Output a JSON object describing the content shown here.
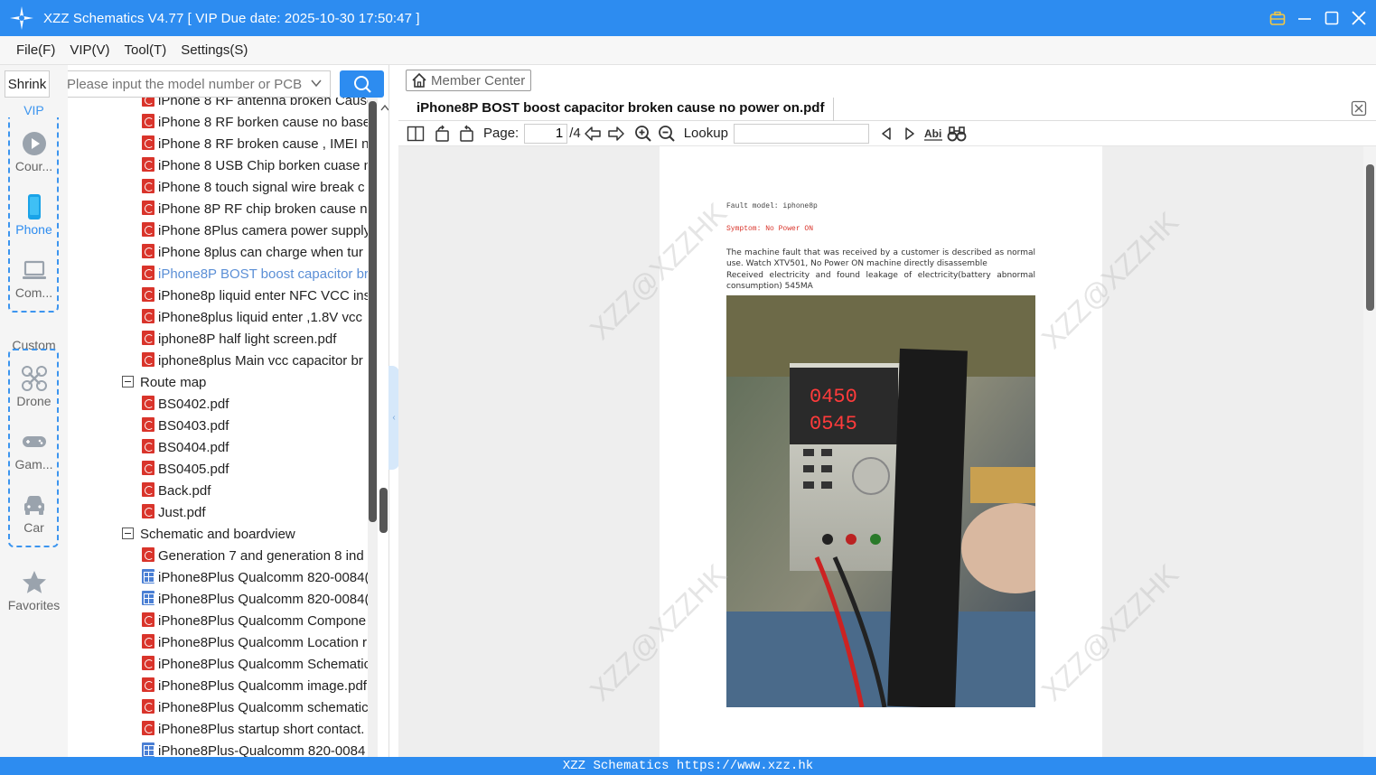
{
  "titlebar": {
    "title": "XZZ Schematics V4.77 [ VIP Due date: 2025-10-30 17:50:47 ]"
  },
  "menu": [
    "File(F)",
    "VIP(V)",
    "Tool(T)",
    "Settings(S)"
  ],
  "rail": {
    "shrink_label": "Shrink",
    "vip_group_label": "VIP",
    "custom_group_label": "Custom",
    "items": [
      {
        "label": "Cour...",
        "icon": "play-circle-icon"
      },
      {
        "label": "Phone",
        "icon": "phone-icon"
      },
      {
        "label": "Com...",
        "icon": "laptop-icon"
      },
      {
        "label": "Drone",
        "icon": "drone-icon"
      },
      {
        "label": "Gam...",
        "icon": "gamepad-icon"
      },
      {
        "label": "Car",
        "icon": "car-icon"
      },
      {
        "label": "Favorites",
        "icon": "star-icon"
      }
    ]
  },
  "search": {
    "placeholder": "Please input the model number or PCB"
  },
  "tree": {
    "rows": [
      {
        "label": "iPhone 8 RF antenna broken Cause",
        "type": "pdf"
      },
      {
        "label": "iPhone 8 RF borken cause no base",
        "type": "pdf"
      },
      {
        "label": "iPhone 8 RF broken cause , IMEI no",
        "type": "pdf"
      },
      {
        "label": "iPhone 8 USB Chip borken cuase n",
        "type": "pdf"
      },
      {
        "label": "iPhone 8 touch signal wire break c",
        "type": "pdf"
      },
      {
        "label": "iPhone 8P RF chip broken cause no",
        "type": "pdf"
      },
      {
        "label": "iPhone 8Plus camera power supply",
        "type": "pdf"
      },
      {
        "label": "iPhone 8plus can charge when tur",
        "type": "pdf"
      },
      {
        "label": "iPhone8P BOST boost capacitor br",
        "type": "pdf",
        "highlight": true
      },
      {
        "label": "iPhone8p liquid enter NFC VCC ins",
        "type": "pdf"
      },
      {
        "label": "iPhone8plus liquid enter ,1.8V vcc",
        "type": "pdf"
      },
      {
        "label": "iphone8P half light screen.pdf",
        "type": "pdf"
      },
      {
        "label": "iphone8plus Main vcc capacitor br",
        "type": "pdf"
      },
      {
        "label": "Route map",
        "type": "folder"
      },
      {
        "label": "BS0402.pdf",
        "type": "pdf"
      },
      {
        "label": "BS0403.pdf",
        "type": "pdf"
      },
      {
        "label": "BS0404.pdf",
        "type": "pdf"
      },
      {
        "label": "BS0405.pdf",
        "type": "pdf"
      },
      {
        "label": "Back.pdf",
        "type": "pdf"
      },
      {
        "label": "Just.pdf",
        "type": "pdf"
      },
      {
        "label": "Schematic and boardview",
        "type": "folder"
      },
      {
        "label": "Generation 7 and generation 8 ind",
        "type": "pdf"
      },
      {
        "label": "iPhone8Plus Qualcomm 820-0084(",
        "type": "board"
      },
      {
        "label": "iPhone8Plus Qualcomm 820-0084(",
        "type": "board"
      },
      {
        "label": "iPhone8Plus Qualcomm Compone",
        "type": "pdf"
      },
      {
        "label": "iPhone8Plus Qualcomm Location r",
        "type": "pdf"
      },
      {
        "label": "iPhone8Plus Qualcomm Schematic",
        "type": "pdf"
      },
      {
        "label": "iPhone8Plus Qualcomm image.pdf",
        "type": "pdf"
      },
      {
        "label": "iPhone8Plus Qualcomm schematic",
        "type": "pdf"
      },
      {
        "label": "iPhone8Plus startup short contact.",
        "type": "pdf"
      },
      {
        "label": "iPhone8Plus-Qualcomm 820-0084",
        "type": "board"
      }
    ]
  },
  "viewer": {
    "member_center_label": "Member Center",
    "tab_title": "iPhone8P BOST boost capacitor broken cause no power on.pdf",
    "toolbar": {
      "page_label": "Page:",
      "page_value": "1",
      "page_total": "/4",
      "lookup_label": "Lookup",
      "lookup_value": ""
    },
    "document": {
      "fault_model": "Fault model: iphone8p",
      "symptom": "Symptom: No Power ON",
      "paragraph1": "The machine fault that was received by a customer is described as normal use. Watch XTV501, No Power ON machine directly disassemble",
      "paragraph2": "Received electricity and found leakage of electricity(battery abnormal consumption) 545MA",
      "display_top": "0450",
      "display_bottom": "0545",
      "watermark": "XZZ@XZZHK"
    }
  },
  "footer": {
    "text": "XZZ Schematics https://www.xzz.hk"
  },
  "colors": {
    "brand_blue": "#2d8cf0",
    "pdf_red": "#d9342b",
    "highlight_blue": "#5b8fd6"
  }
}
